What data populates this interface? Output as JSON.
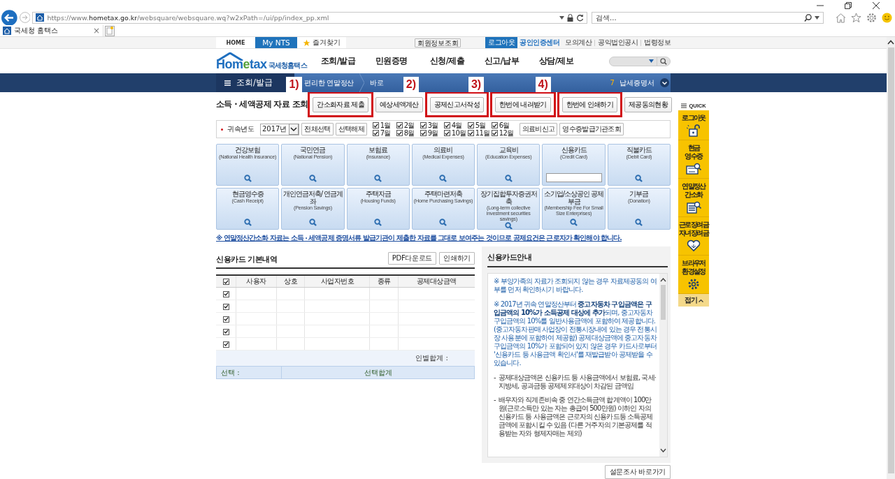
{
  "browser": {
    "url": "https://www.**hometax.go.kr**/websquare/websquare.wq?w2xPath=/ui/pp/index_pp.xml",
    "search_placeholder": "검색...",
    "tab_title": "국세청 홈택스",
    "tab_close": "×"
  },
  "topbar": {
    "links": [
      {
        "label": "HOME",
        "kind": "plain"
      },
      {
        "label": "My NTS",
        "kind": "primary"
      },
      {
        "label": "즐겨찾기",
        "kind": "favorite"
      }
    ],
    "member_button": "회원정보조회",
    "logout_button": "로그아웃",
    "cert_link": "공인인증센터",
    "util_links": [
      "모의계산",
      "공익법인공시",
      "법령정보"
    ]
  },
  "header": {
    "logo_start": "Hom",
    "logo_accent": "e",
    "logo_end": "tax",
    "logo_name": "국세청홈택스",
    "nav": [
      "조회/발급",
      "민원증명",
      "신청/제출",
      "신고/납부",
      "상담/제보"
    ]
  },
  "menubar": {
    "menu": "조회/발급",
    "crumbs": [
      "편리한 연말정산",
      "바로"
    ],
    "ticker_number": "7",
    "ticker_text": "납세증명서"
  },
  "page_title": "소득 · 세액공제 자료 조회",
  "actions": [
    {
      "label": "간소화자료 제출",
      "annotation": "1)"
    },
    {
      "label": "예상세액계산"
    },
    {
      "label": "공제신고서작성",
      "annotation": "2)"
    },
    {
      "label": "한번에 내려받기",
      "annotation": "3)"
    },
    {
      "label": "한번에 인쇄하기",
      "annotation": "4)"
    },
    {
      "label": "제공동의현황"
    }
  ],
  "filter": {
    "label": "귀속년도",
    "year": "2017년",
    "buttons": [
      "전체선택",
      "선택해제"
    ],
    "months": [
      {
        "label": "1월",
        "checked": true
      },
      {
        "label": "2월",
        "checked": true
      },
      {
        "label": "3월",
        "checked": true
      },
      {
        "label": "4월",
        "checked": true
      },
      {
        "label": "5월",
        "checked": true
      },
      {
        "label": "6월",
        "checked": true
      },
      {
        "label": "7월",
        "checked": true
      },
      {
        "label": "8월",
        "checked": true
      },
      {
        "label": "9월",
        "checked": true
      },
      {
        "label": "10월",
        "checked": true
      },
      {
        "label": "11월",
        "checked": true
      },
      {
        "label": "12월",
        "checked": true
      }
    ],
    "right_buttons": [
      "의료비신고",
      "영수증발급기관조회"
    ]
  },
  "tiles": [
    {
      "title": "건강보험",
      "subtitle": "(National Health Insurance)",
      "kind": "search"
    },
    {
      "title": "국민연금",
      "subtitle": "(National Pension)",
      "kind": "search"
    },
    {
      "title": "보험료",
      "subtitle": "(Insurance)",
      "kind": "search"
    },
    {
      "title": "의료비",
      "subtitle": "(Medical Expenses)",
      "kind": "search"
    },
    {
      "title": "교육비",
      "subtitle": "(Education Expenses)",
      "kind": "search"
    },
    {
      "title": "신용카드",
      "subtitle": "(Credit Card)",
      "kind": "input"
    },
    {
      "title": "직불카드",
      "subtitle": "(Debit Card)",
      "kind": "search"
    },
    {
      "title": "현금영수증",
      "subtitle": "(Cash Receipt)",
      "kind": "search"
    },
    {
      "title": "개인연금저축/ 연금계좌",
      "subtitle": "(Pension Savings)",
      "kind": "search"
    },
    {
      "title": "주택자금",
      "subtitle": "(Housing Funds)",
      "kind": "search"
    },
    {
      "title": "주택마련저축",
      "subtitle": "(Home Purchasing Savings)",
      "kind": "search"
    },
    {
      "title": "장기집합투자증권저축",
      "subtitle": "(Long-term collective investment securities savings)",
      "kind": "search"
    },
    {
      "title": "소기업/소상공인 공제부금",
      "subtitle": "(Membership Fee For Small Size Enterprises)",
      "kind": "search"
    },
    {
      "title": "기부금",
      "subtitle": "(Donation)",
      "kind": "search"
    }
  ],
  "notice": "※ 연말정산간소화 자료는 소득 · 세액공제 증명서류 발급기관이 제출한 자료를 그대로 보여주는 것이므로 공제요건은 근로자가 확인해야 합니다.",
  "card_table": {
    "title": "신용카드 기본내역",
    "buttons": [
      "PDF다운로드",
      "인쇄하기"
    ],
    "header_checked": true,
    "columns": [
      "사용자",
      "상호",
      "사업자번호",
      "종류",
      "공제대상금액"
    ],
    "rows": [
      {
        "checked": true
      },
      {
        "checked": true
      },
      {
        "checked": true
      },
      {
        "checked": true
      },
      {
        "checked": true
      }
    ],
    "subtotal_label": "인별합계 :",
    "select_label": "선택 :",
    "select_total_label": "선택합계"
  },
  "guide": {
    "title": "신용카드안내",
    "notes": [
      "※ 부양가족의 자료가 조회되지 않는 경우 자료제공동의 여부를 먼저 확인하시기 바랍니다.",
      "※ 2017년 귀속 연말정산부터 **중고자동차 구입금액은 구입금액의 10%가 소득공제 대상에 추가**되며, 중고자동차 구입금액의 10%를 일반사용금액에 포함하여 제공합니다. (중고자동차판매 사업장이 전통시장내에 있는 경우 전통시장 사용분에 포함하여 제공함) 공제대상금액에 중고자동차 구입금액의 10%가 포함되어 있지 않은 경우 카드사로부터 '신용카드 등 사용금액 확인서'를 재발급받아 공제받을 수 있습니다."
    ],
    "bullets": [
      {
        "marker": "-",
        "text": "공제대상금액은 신용카드 등 사용금액에서 보험료, 국세·지방세, 공과금등 공제제외대상이 차감된 금액임"
      },
      {
        "marker": "-",
        "text": "배우자와 직계존비속 중 연간소득금액 합계액이 100만원(근로소득만 있는 자는 총급여 500만원) 이하인 자의 신용카드 등 사용금액은 근로자의 신용카드등 소득공제금액에 포함시킬 수 있음 (다른 거주자의 기본공제를 적용받는 자와 형제자매는 제외)"
      }
    ]
  },
  "survey_button": "설문조사 바로가기",
  "quick": {
    "title": "QUICK",
    "items": [
      {
        "lines": [
          "로그아웃"
        ],
        "kind": "lock"
      },
      {
        "lines": [
          "현금",
          "영수증"
        ],
        "kind": "receipt"
      },
      {
        "lines": [
          "연말정산",
          "간소화"
        ],
        "kind": "document"
      },
      {
        "lines": [
          "근로장려금",
          "자녀장려금"
        ],
        "kind": "heart"
      },
      {
        "lines": [
          "브라우저",
          "환경설정"
        ],
        "kind": "gear"
      }
    ],
    "collapse": "접기"
  }
}
